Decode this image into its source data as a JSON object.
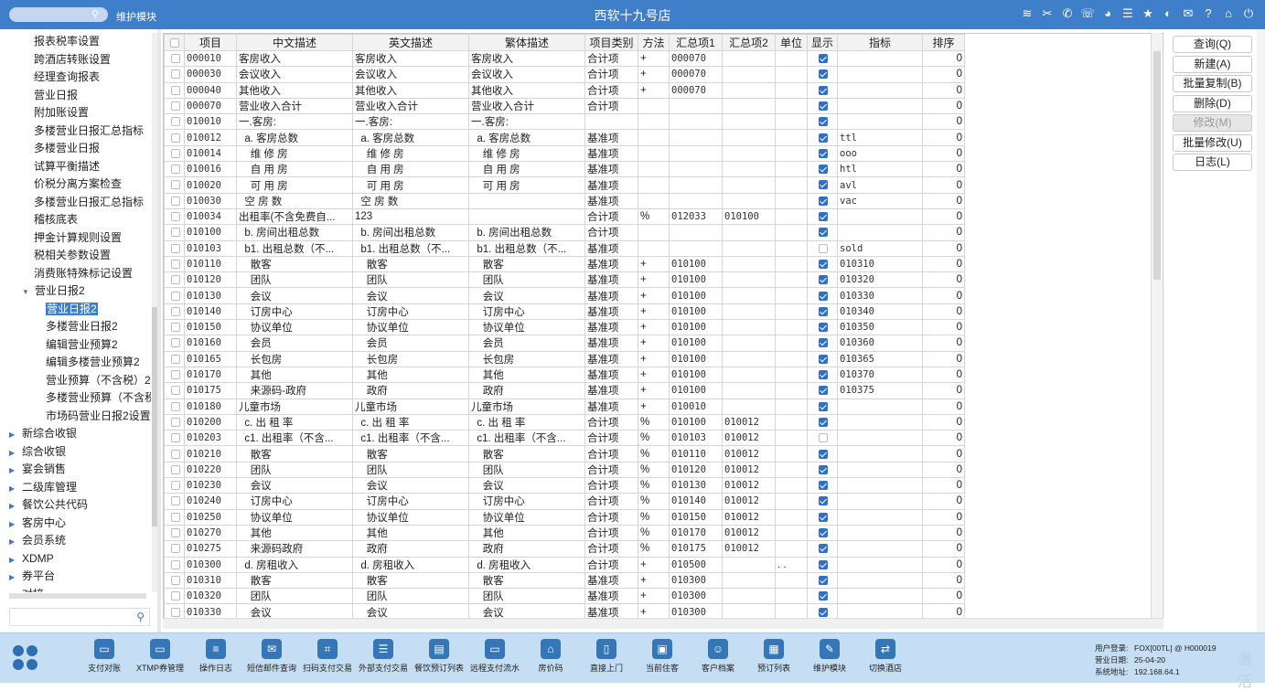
{
  "topbar": {
    "module": "维护模块",
    "title": "西软十九号店",
    "icons": [
      "wifi-icon",
      "tools-icon",
      "phone-icon",
      "assist-icon",
      "palette-icon",
      "menu-icon",
      "star-icon",
      "moon-icon",
      "mail-icon",
      "help-icon",
      "home-icon",
      "power-icon"
    ]
  },
  "sidebar": {
    "items": [
      {
        "label": "报表税率设置",
        "level": 1
      },
      {
        "label": "跨酒店转账设置",
        "level": 1
      },
      {
        "label": "经理查询报表",
        "level": 1
      },
      {
        "label": "营业日报",
        "level": 1
      },
      {
        "label": "附加账设置",
        "level": 1
      },
      {
        "label": "多楼营业日报汇总指标",
        "level": 1
      },
      {
        "label": "多楼营业日报",
        "level": 1
      },
      {
        "label": "试算平衡描述",
        "level": 1
      },
      {
        "label": "价税分离方案检查",
        "level": 1
      },
      {
        "label": "多楼营业日报汇总指标",
        "level": 1
      },
      {
        "label": "稽核底表",
        "level": 1
      },
      {
        "label": "押金计算规则设置",
        "level": 1
      },
      {
        "label": "税相关参数设置",
        "level": 1
      },
      {
        "label": "消费账特殊标记设置",
        "level": 1
      },
      {
        "label": "营业日报2",
        "level": 1,
        "expanded": true
      },
      {
        "label": "营业日报2",
        "level": 2,
        "selected": true
      },
      {
        "label": "多楼营业日报2",
        "level": 2
      },
      {
        "label": "编辑营业预算2",
        "level": 2
      },
      {
        "label": "编辑多楼营业预算2",
        "level": 2
      },
      {
        "label": "营业预算（不含税）2",
        "level": 2
      },
      {
        "label": "多楼营业预算（不含税",
        "level": 2
      },
      {
        "label": "市场码营业日报2设置",
        "level": 2
      },
      {
        "label": "新综合收银",
        "level": 0
      },
      {
        "label": "综合收银",
        "level": 0
      },
      {
        "label": "宴会销售",
        "level": 0
      },
      {
        "label": "二级库管理",
        "level": 0
      },
      {
        "label": "餐饮公共代码",
        "level": 0
      },
      {
        "label": "客房中心",
        "level": 0
      },
      {
        "label": "会员系统",
        "level": 0
      },
      {
        "label": "XDMP",
        "level": 0
      },
      {
        "label": "券平台",
        "level": 0
      },
      {
        "label": "对接",
        "level": 0
      }
    ]
  },
  "grid": {
    "headers": [
      "项目",
      "中文描述",
      "英文描述",
      "繁体描述",
      "项目类别",
      "方法",
      "汇总项1",
      "汇总项2",
      "单位",
      "显示",
      "指标",
      "排序"
    ],
    "rows": [
      [
        "000010",
        "客房收入",
        "客房收入",
        "客房收入",
        "合计项",
        "+",
        "000070",
        "",
        "",
        true,
        "",
        "0"
      ],
      [
        "000030",
        "会议收入",
        "会议收入",
        "会议收入",
        "合计项",
        "+",
        "000070",
        "",
        "",
        true,
        "",
        "0"
      ],
      [
        "000040",
        "其他收入",
        "其他收入",
        "其他收入",
        "合计项",
        "+",
        "000070",
        "",
        "",
        true,
        "",
        "0"
      ],
      [
        "000070",
        "营业收入合计",
        "营业收入合计",
        "营业收入合计",
        "合计项",
        "",
        "",
        "",
        "",
        true,
        "",
        "0"
      ],
      [
        "010010",
        "一.客房:",
        "一.客房:",
        "一.客房:",
        "",
        "",
        "",
        "",
        "",
        true,
        "",
        "0"
      ],
      [
        "010012",
        "  a. 客房总数",
        "  a. 客房总数",
        "  a. 客房总数",
        "基准项",
        "",
        "",
        "",
        "",
        true,
        "ttl",
        "0"
      ],
      [
        "010014",
        "    维 修 房",
        "    维 修 房",
        "    维 修 房",
        "基准项",
        "",
        "",
        "",
        "",
        true,
        "ooo",
        "0"
      ],
      [
        "010016",
        "    自 用 房",
        "    自 用 房",
        "    自 用 房",
        "基准项",
        "",
        "",
        "",
        "",
        true,
        "htl",
        "0"
      ],
      [
        "010020",
        "    可 用 房",
        "    可 用 房",
        "    可 用 房",
        "基准项",
        "",
        "",
        "",
        "",
        true,
        "avl",
        "0"
      ],
      [
        "010030",
        "  空 房 数",
        "  空 房 数",
        "",
        "基准项",
        "",
        "",
        "",
        "",
        true,
        "vac",
        "0"
      ],
      [
        "010034",
        "出租率(不含免费自...",
        "123",
        "",
        "合计项",
        "%",
        "012033",
        "010100",
        "",
        true,
        "",
        "0"
      ],
      [
        "010100",
        "  b. 房间出租总数",
        "  b. 房间出租总数",
        "  b. 房间出租总数",
        "合计项",
        "",
        "",
        "",
        "",
        true,
        "",
        "0"
      ],
      [
        "010103",
        "  b1. 出租总数（不...",
        "  b1. 出租总数（不...",
        "  b1. 出租总数（不...",
        "基准项",
        "",
        "",
        "",
        "",
        false,
        "sold",
        "0"
      ],
      [
        "010110",
        "    散客",
        "    散客",
        "    散客",
        "基准项",
        "+",
        "010100",
        "",
        "",
        true,
        "010310",
        "0"
      ],
      [
        "010120",
        "    团队",
        "    团队",
        "    团队",
        "基准项",
        "+",
        "010100",
        "",
        "",
        true,
        "010320",
        "0"
      ],
      [
        "010130",
        "    会议",
        "    会议",
        "    会议",
        "基准项",
        "+",
        "010100",
        "",
        "",
        true,
        "010330",
        "0"
      ],
      [
        "010140",
        "    订房中心",
        "    订房中心",
        "    订房中心",
        "基准项",
        "+",
        "010100",
        "",
        "",
        true,
        "010340",
        "0"
      ],
      [
        "010150",
        "    协议单位",
        "    协议单位",
        "    协议单位",
        "基准项",
        "+",
        "010100",
        "",
        "",
        true,
        "010350",
        "0"
      ],
      [
        "010160",
        "    会员",
        "    会员",
        "    会员",
        "基准项",
        "+",
        "010100",
        "",
        "",
        true,
        "010360",
        "0"
      ],
      [
        "010165",
        "    长包房",
        "    长包房",
        "    长包房",
        "基准项",
        "+",
        "010100",
        "",
        "",
        true,
        "010365",
        "0"
      ],
      [
        "010170",
        "    其他",
        "    其他",
        "    其他",
        "基准项",
        "+",
        "010100",
        "",
        "",
        true,
        "010370",
        "0"
      ],
      [
        "010175",
        "    来源码-政府",
        "    政府",
        "    政府",
        "基准项",
        "+",
        "010100",
        "",
        "",
        true,
        "010375",
        "0"
      ],
      [
        "010180",
        "儿童市场",
        "儿童市场",
        "儿童市场",
        "基准项",
        "+",
        "010010",
        "",
        "",
        true,
        "",
        "0"
      ],
      [
        "010200",
        "  c. 出 租 率",
        "  c. 出 租 率",
        "  c. 出 租 率",
        "合计项",
        "%",
        "010100",
        "010012",
        "",
        true,
        "",
        "0"
      ],
      [
        "010203",
        "  c1. 出租率（不含...",
        "  c1. 出租率（不含...",
        "  c1. 出租率（不含...",
        "合计项",
        "%",
        "010103",
        "010012",
        "",
        false,
        "",
        "0"
      ],
      [
        "010210",
        "    散客",
        "    散客",
        "    散客",
        "合计项",
        "%",
        "010110",
        "010012",
        "",
        true,
        "",
        "0"
      ],
      [
        "010220",
        "    团队",
        "    团队",
        "    团队",
        "合计项",
        "%",
        "010120",
        "010012",
        "",
        true,
        "",
        "0"
      ],
      [
        "010230",
        "    会议",
        "    会议",
        "    会议",
        "合计项",
        "%",
        "010130",
        "010012",
        "",
        true,
        "",
        "0"
      ],
      [
        "010240",
        "    订房中心",
        "    订房中心",
        "    订房中心",
        "合计项",
        "%",
        "010140",
        "010012",
        "",
        true,
        "",
        "0"
      ],
      [
        "010250",
        "    协议单位",
        "    协议单位",
        "    协议单位",
        "合计项",
        "%",
        "010150",
        "010012",
        "",
        true,
        "",
        "0"
      ],
      [
        "010270",
        "    其他",
        "    其他",
        "    其他",
        "合计项",
        "%",
        "010170",
        "010012",
        "",
        true,
        "",
        "0"
      ],
      [
        "010275",
        "    来源码政府",
        "    政府",
        "    政府",
        "合计项",
        "%",
        "010175",
        "010012",
        "",
        true,
        "",
        "0"
      ],
      [
        "010300",
        "  d. 房租收入",
        "  d. 房租收入",
        "  d. 房租收入",
        "合计项",
        "+",
        "010500",
        "",
        ". .",
        true,
        "",
        "0"
      ],
      [
        "010310",
        "    散客",
        "    散客",
        "    散客",
        "基准项",
        "+",
        "010300",
        "",
        "",
        true,
        "",
        "0"
      ],
      [
        "010320",
        "    团队",
        "    团队",
        "    团队",
        "基准项",
        "+",
        "010300",
        "",
        "",
        true,
        "",
        "0"
      ],
      [
        "010330",
        "    会议",
        "    会议",
        "    会议",
        "基准项",
        "+",
        "010300",
        "",
        "",
        true,
        "",
        "0"
      ]
    ]
  },
  "buttons": [
    {
      "label": "查询(Q)",
      "enabled": true
    },
    {
      "label": "新建(A)",
      "enabled": true
    },
    {
      "label": "批量复制(B)",
      "enabled": true
    },
    {
      "label": "删除(D)",
      "enabled": true
    },
    {
      "label": "修改(M)",
      "enabled": false
    },
    {
      "label": "批量修改(U)",
      "enabled": true
    },
    {
      "label": "日志(L)",
      "enabled": true
    }
  ],
  "dock": [
    {
      "label": "支付对账",
      "icon": "▭"
    },
    {
      "label": "XTMP券管理",
      "icon": "▭"
    },
    {
      "label": "操作日志",
      "icon": "≡"
    },
    {
      "label": "短信邮件查询",
      "icon": "✉"
    },
    {
      "label": "扫码支付交易",
      "icon": "⌗"
    },
    {
      "label": "外部支付交易",
      "icon": "☰"
    },
    {
      "label": "餐饮预订列表",
      "icon": "▤"
    },
    {
      "label": "远程支付流水",
      "icon": "▭"
    },
    {
      "label": "房价码",
      "icon": "⌂"
    },
    {
      "label": "直接上门",
      "icon": "▯"
    },
    {
      "label": "当前住客",
      "icon": "▣"
    },
    {
      "label": "客户档案",
      "icon": "☺"
    },
    {
      "label": "预订列表",
      "icon": "▦"
    },
    {
      "label": "维护模块",
      "icon": "✎"
    },
    {
      "label": "切换酒店",
      "icon": "⇄"
    }
  ],
  "sysinfo": {
    "user_key": "用户登录:",
    "user_val": "FOX[00TL] @ H000019",
    "date_key": "营业日期:",
    "date_val": "25-04-20",
    "addr_key": "系统地址:",
    "addr_val": "192.168.64.1"
  },
  "watermark": "激活"
}
